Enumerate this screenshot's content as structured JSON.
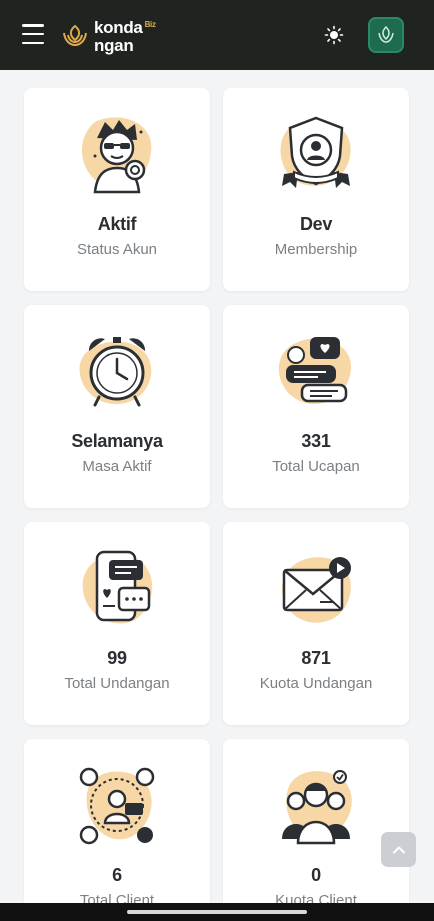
{
  "header": {
    "brand_line1": "konda",
    "brand_line2": "ngan",
    "brand_accent": "Biz",
    "menu_icon": "hamburger-icon",
    "theme_icon": "sun-icon",
    "avatar_icon": "leaf-logo-icon"
  },
  "cards": [
    {
      "value": "Aktif",
      "label": "Status Akun",
      "icon": "user-status-icon"
    },
    {
      "value": "Dev",
      "label": "Membership",
      "icon": "membership-badge-icon"
    },
    {
      "value": "Selamanya",
      "label": "Masa Aktif",
      "icon": "alarm-clock-icon"
    },
    {
      "value": "331",
      "label": "Total Ucapan",
      "icon": "chat-bubbles-icon"
    },
    {
      "value": "99",
      "label": "Total Undangan",
      "icon": "phone-invitation-icon"
    },
    {
      "value": "871",
      "label": "Kuota Undangan",
      "icon": "envelope-icon"
    },
    {
      "value": "6",
      "label": "Total Client",
      "icon": "network-users-icon"
    },
    {
      "value": "0",
      "label": "Kuota Client",
      "icon": "group-users-icon"
    }
  ],
  "colors": {
    "topbar": "#1f2421",
    "accent": "#e0a94a",
    "blob": "#f7d7a6",
    "avatar": "#1e6b50"
  },
  "scroll_top_icon": "chevron-up-icon"
}
